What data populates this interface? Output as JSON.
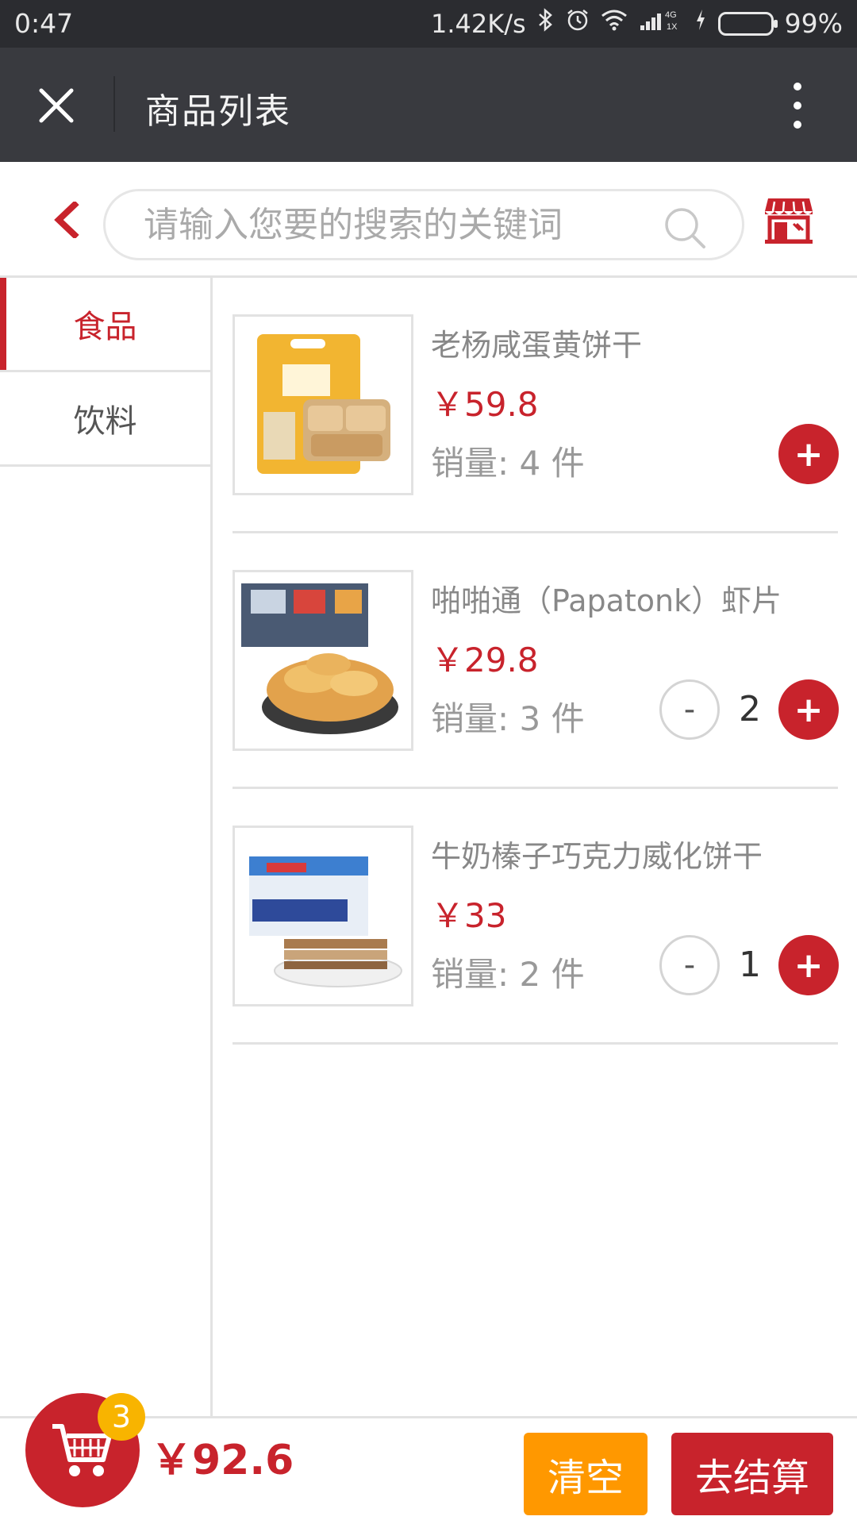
{
  "status_bar": {
    "time": "0:47",
    "network_speed": "1.42K/s",
    "network_type": "4G",
    "sim": "1X",
    "battery": "99%",
    "battery_level": 0.99,
    "icons": [
      "bluetooth-icon",
      "alarm-icon",
      "wifi-icon",
      "signal-icon",
      "charging-icon",
      "battery-icon"
    ]
  },
  "header": {
    "title": "商品列表",
    "close_icon": "close-icon",
    "more_icon": "more-icon"
  },
  "search": {
    "placeholder": "请输入您要的搜索的关键词",
    "value": ""
  },
  "categories": [
    {
      "label": "食品",
      "active": true
    },
    {
      "label": "饮料",
      "active": false
    }
  ],
  "products": [
    {
      "name": "老杨咸蛋黄饼干",
      "price": "￥59.8",
      "sales": "销量: 4 件",
      "quantity": null
    },
    {
      "name": "啪啪通（Papatonk）虾片",
      "price": "￥29.8",
      "sales": "销量: 3 件",
      "quantity": "2"
    },
    {
      "name": "牛奶榛子巧克力威化饼干",
      "price": "￥33",
      "sales": "销量: 2 件",
      "quantity": "1"
    }
  ],
  "controls": {
    "plus": "+",
    "minus": "-"
  },
  "cart": {
    "count": "3",
    "total": "￥92.6",
    "clear_label": "清空",
    "checkout_label": "去结算"
  },
  "colors": {
    "accent": "#c8232c",
    "clear_button": "#ff9800",
    "badge": "#f8b400",
    "header_bg": "#393a3f"
  }
}
